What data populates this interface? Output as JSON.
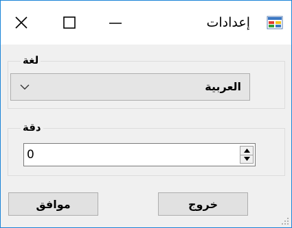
{
  "window": {
    "title": "إعدادات",
    "border_color": "#1883d7",
    "icons": {
      "close": "close-icon",
      "maximize": "maximize-icon",
      "minimize": "minimize-icon",
      "app": "app-icon"
    }
  },
  "language_group": {
    "label": "لغة",
    "select": {
      "selected": "العربية",
      "icon": "chevron-down-icon"
    }
  },
  "precision_group": {
    "label": "دقة",
    "numeric": {
      "value": "0",
      "icons": [
        "spin-up-icon",
        "spin-down-icon"
      ]
    }
  },
  "buttons": {
    "exit": "خروج",
    "ok": "موافق"
  }
}
